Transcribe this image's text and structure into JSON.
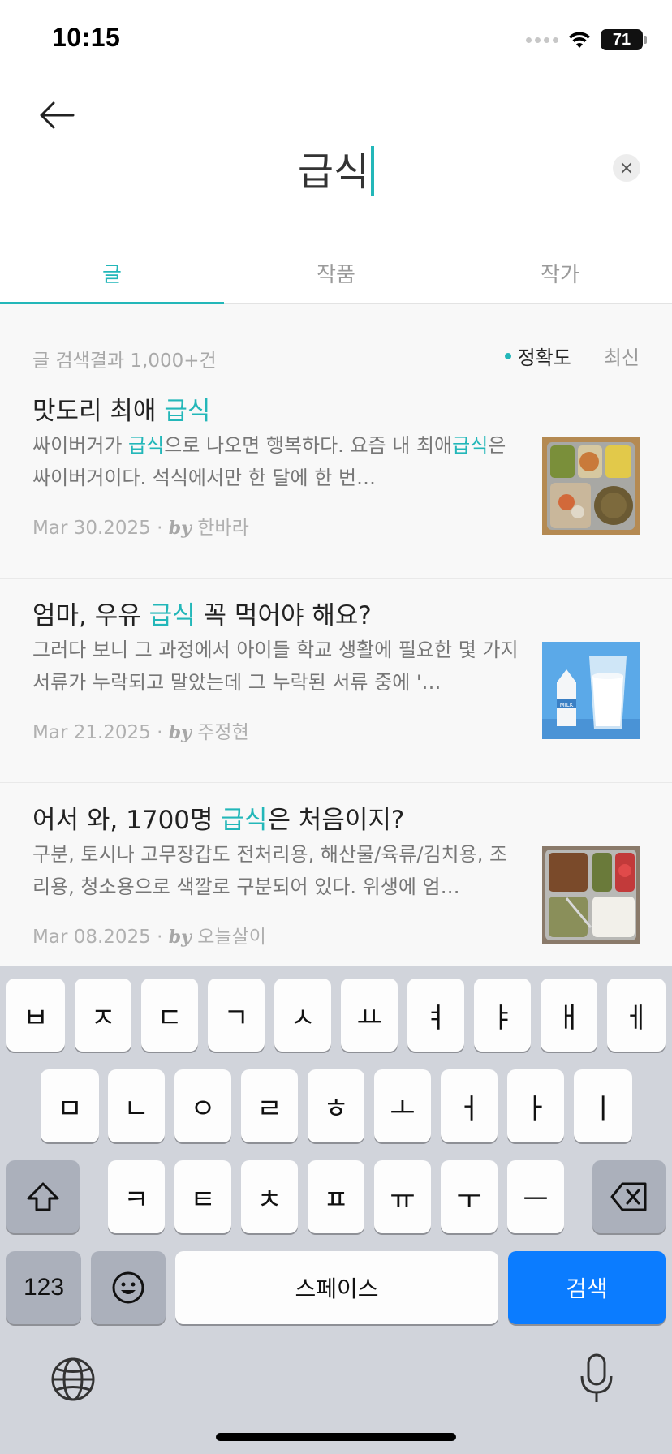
{
  "status_bar": {
    "time": "10:15",
    "battery": "71"
  },
  "header": {
    "search_value": "급식",
    "back_icon": "arrow-left-icon",
    "clear_icon": "close-icon",
    "clear_glyph": "×"
  },
  "tabs": [
    {
      "label": "글",
      "active": true
    },
    {
      "label": "작품",
      "active": false
    },
    {
      "label": "작가",
      "active": false
    }
  ],
  "results": {
    "count_label": "글 검색결과 1,000+건",
    "sort_options": [
      "정확도",
      "최신"
    ],
    "items": [
      {
        "title_pre": "맛도리 최애 ",
        "title_hl": "급식",
        "title_post": "",
        "ex1_pre": "싸이버거가 ",
        "ex1_hl": "급식",
        "ex1_post": "으로 나오면 행복하다. 요즘 내 ",
        "ex2_pre": "최애",
        "ex2_hl": "급식",
        "ex2_post": "은 싸이버거이다. 석식에서만 한 달에 한 번…",
        "date": "Mar 30.2025",
        "sep": " · ",
        "by": "by",
        "author": "한바라"
      },
      {
        "title_pre": "엄마, 우유 ",
        "title_hl": "급식",
        "title_post": " 꼭 먹어야 해요?",
        "ex1_pre": "그러다 보니 그 과정에서 아이들 학교 생활에 필요한 몇 가지 서류가 누락되고 말았는데 그 누락된 서류 중에 '…",
        "ex1_hl": "",
        "ex1_post": "",
        "ex2_pre": "",
        "ex2_hl": "",
        "ex2_post": "",
        "date": "Mar 21.2025",
        "sep": " · ",
        "by": "by",
        "author": "주정현",
        "thumb_text": "MILK"
      },
      {
        "title_pre": "어서 와, 1700명 ",
        "title_hl": "급식",
        "title_post": "은 처음이지?",
        "ex1_pre": "구분, 토시나 고무장갑도 전처리용, 해산물/육류/김치용, 조리용, 청소용으로 색깔로 구분되어 있다. 위생에 엄…",
        "ex1_hl": "",
        "ex1_post": "",
        "ex2_pre": "",
        "ex2_hl": "",
        "ex2_post": "",
        "date": "Mar 08.2025",
        "sep": " · ",
        "by": "by",
        "author": "오늘살이"
      }
    ]
  },
  "keyboard": {
    "row1": [
      "ㅂ",
      "ㅈ",
      "ㄷ",
      "ㄱ",
      "ㅅ",
      "ㅛ",
      "ㅕ",
      "ㅑ",
      "ㅐ",
      "ㅔ"
    ],
    "row2": [
      "ㅁ",
      "ㄴ",
      "ㅇ",
      "ㄹ",
      "ㅎ",
      "ㅗ",
      "ㅓ",
      "ㅏ",
      "ㅣ"
    ],
    "row3": [
      "ㅋ",
      "ㅌ",
      "ㅊ",
      "ㅍ",
      "ㅠ",
      "ㅜ",
      "ㅡ"
    ],
    "numbers_label": "123",
    "space_label": "스페이스",
    "search_label": "검색",
    "accent_color": "#0b7cff"
  },
  "colors": {
    "accent": "#23b7b9"
  }
}
